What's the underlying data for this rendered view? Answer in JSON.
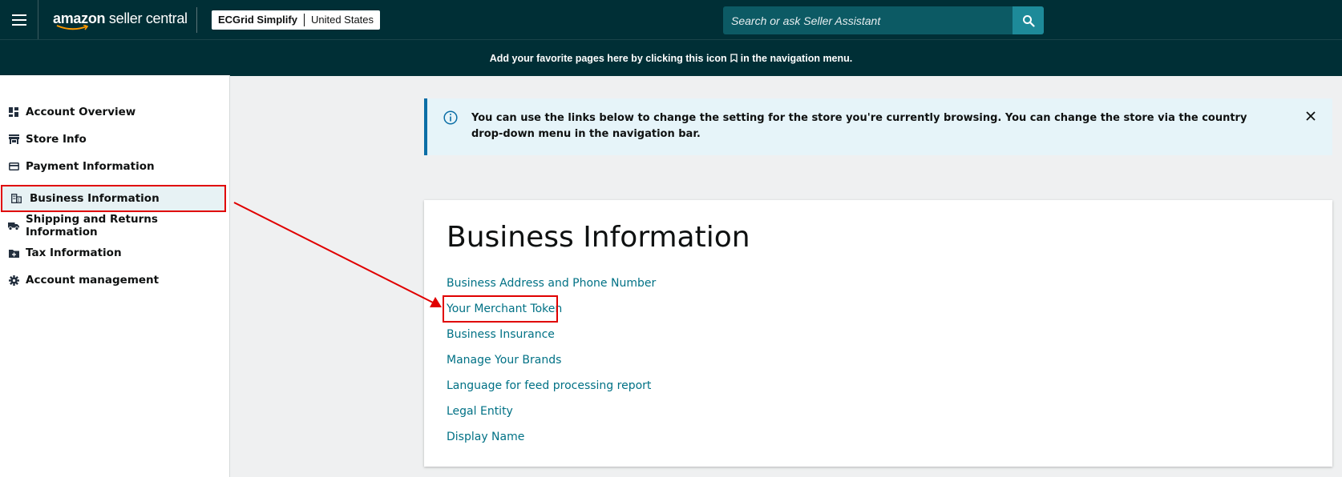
{
  "header": {
    "logo_text": "amazon seller central",
    "logo_bold": "amazon",
    "logo_rest": " seller central",
    "account_name": "ECGrid Simplify",
    "marketplace": "United States",
    "search_placeholder": "Search or ask Seller Assistant"
  },
  "favorites_bar": {
    "text_before": "Add your favorite pages here by clicking this icon",
    "text_after": "in the navigation menu."
  },
  "sidebar": {
    "items": [
      {
        "label": "Account Overview",
        "icon": "dashboard-icon"
      },
      {
        "label": "Store Info",
        "icon": "store-icon"
      },
      {
        "label": "Payment Information",
        "icon": "credit-card-icon"
      },
      {
        "label": "Business Information",
        "icon": "building-icon",
        "active": true
      },
      {
        "label": "Shipping and Returns Information",
        "icon": "truck-icon"
      },
      {
        "label": "Tax Information",
        "icon": "tax-folder-icon"
      },
      {
        "label": "Account management",
        "icon": "gear-icon"
      }
    ]
  },
  "alert": {
    "text": "You can use the links below to change the setting for the store you're currently browsing. You can change the store via the country drop-down menu in the navigation bar."
  },
  "card": {
    "title": "Business Information",
    "links": [
      "Business Address and Phone Number",
      "Your Merchant Token",
      "Business Insurance",
      "Manage Your Brands",
      "Language for feed processing report",
      "Legal Entity",
      "Display Name"
    ]
  },
  "colors": {
    "header_bg": "#002f36",
    "link": "#007185",
    "highlight": "#e00000",
    "alert_bg": "#e6f4f9",
    "alert_border": "#0b6ea6"
  }
}
